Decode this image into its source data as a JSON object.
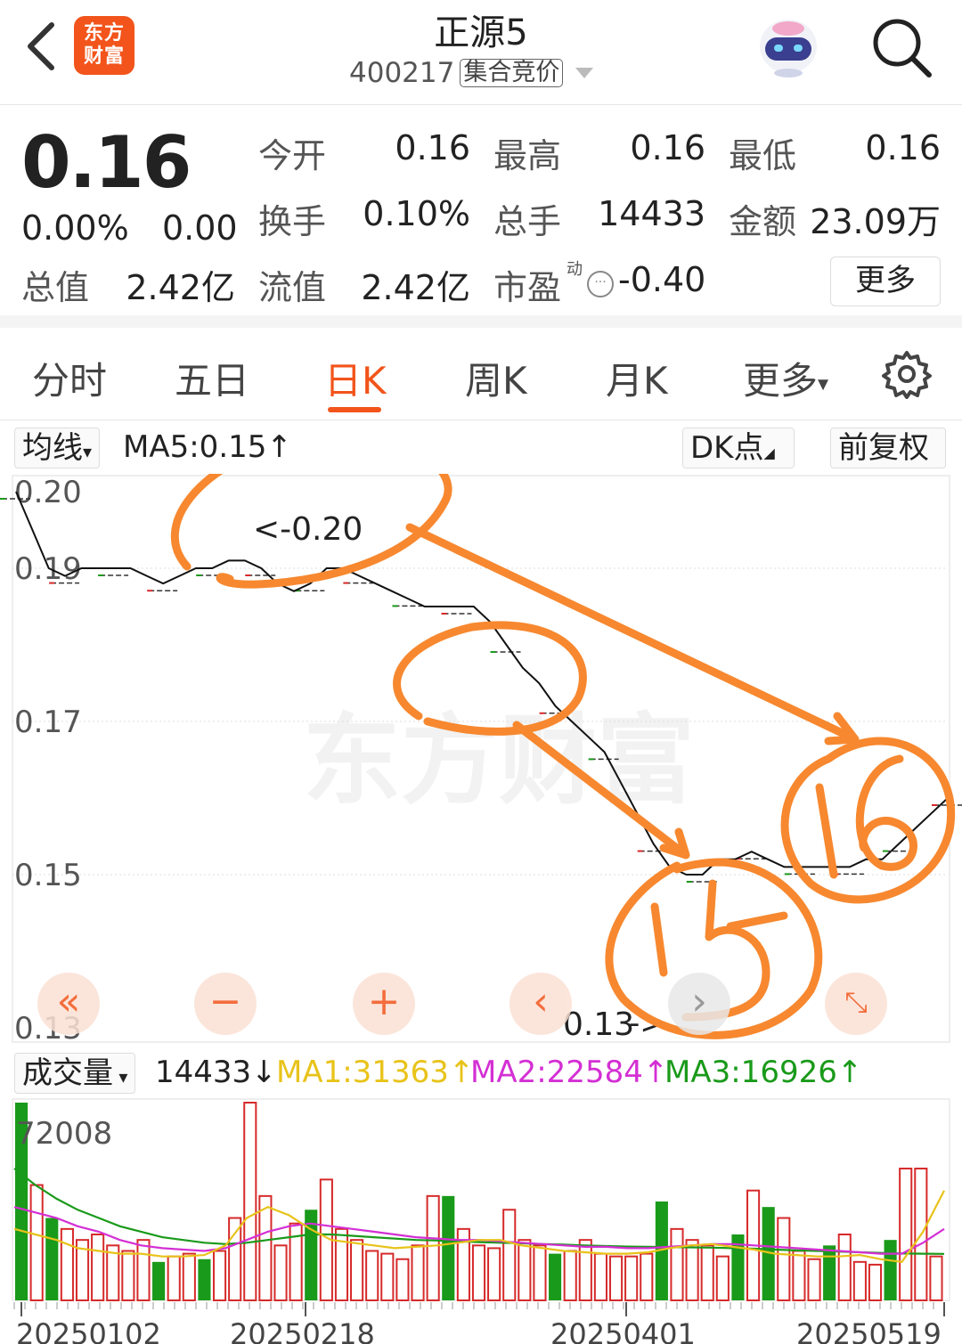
{
  "header": {
    "logo_text_line1": "东方",
    "logo_text_line2": "财富",
    "stock_name": "正源5",
    "stock_code": "400217",
    "auction_tag": "集合竞价"
  },
  "quote": {
    "price": "0.16",
    "change_pct": "0.00%",
    "change": "0.00",
    "open_label": "今开",
    "open": "0.16",
    "high_label": "最高",
    "high": "0.16",
    "low_label": "最低",
    "low": "0.16",
    "turnover_label": "换手",
    "turnover": "0.10%",
    "volume_label": "总手",
    "volume": "14433",
    "amount_label": "金额",
    "amount": "23.09万",
    "mcap_label": "总值",
    "mcap": "2.42亿",
    "float_label": "流值",
    "float": "2.42亿",
    "pe_label": "市盈",
    "pe_sup": "动",
    "pe": "-0.40",
    "more": "更多"
  },
  "tabs": [
    "分时",
    "五日",
    "日K",
    "周K",
    "月K",
    "更多"
  ],
  "active_tab": "日K",
  "indicator": {
    "ma_select": "均线",
    "ma5": "MA5:0.15",
    "dk_button": "DK点",
    "adjust_button": "前复权"
  },
  "volume_row": {
    "select": "成交量",
    "value": "14433",
    "ma1": "MA1:31363",
    "ma2": "MA2:22584",
    "ma3": "MA3:16926"
  },
  "annotations": {
    "top_marker": "<-0.20",
    "bottom_marker": "0.13",
    "handwritten_left": "15",
    "handwritten_right": "16"
  },
  "colors": {
    "brand": "#f2541b",
    "up": "#d62a2a",
    "down": "#1a9a1a",
    "ma1": "#e8c31a",
    "ma2": "#d42fd4",
    "ma3": "#1a9a1a",
    "annotation": "#f7882f"
  },
  "chart_data": [
    {
      "type": "line",
      "y_ticks": [
        "0.20",
        "0.19",
        "0.17",
        "0.15",
        "0.13"
      ],
      "ylim": [
        0.13,
        0.2
      ],
      "x_ticks": [
        "20250102",
        "20250218",
        "20250401",
        "20250519"
      ],
      "series": [
        {
          "name": "MA5",
          "values": [
            0.2,
            0.195,
            0.19,
            0.189,
            0.19,
            0.19,
            0.19,
            0.19,
            0.189,
            0.188,
            0.189,
            0.19,
            0.19,
            0.191,
            0.191,
            0.19,
            0.188,
            0.187,
            0.188,
            0.19,
            0.19,
            0.189,
            0.188,
            0.187,
            0.186,
            0.185,
            0.185,
            0.185,
            0.185,
            0.183,
            0.18,
            0.177,
            0.175,
            0.172,
            0.17,
            0.168,
            0.166,
            0.162,
            0.158,
            0.154,
            0.151,
            0.15,
            0.15,
            0.152,
            0.152,
            0.153,
            0.152,
            0.151,
            0.151,
            0.151,
            0.151,
            0.151,
            0.152,
            0.152,
            0.154,
            0.156,
            0.158,
            0.16
          ]
        }
      ]
    },
    {
      "type": "bar",
      "y_ticks": [
        "72008"
      ],
      "series": [
        {
          "name": "成交量",
          "values": [
            72008,
            42000,
            30000,
            26000,
            22000,
            24000,
            20000,
            18000,
            22000,
            14000,
            16000,
            17000,
            15000,
            18000,
            30000,
            72008,
            38000,
            20000,
            28000,
            33000,
            44000,
            26000,
            22000,
            18000,
            17000,
            15000,
            20000,
            38000,
            38000,
            26000,
            20000,
            19000,
            33000,
            22000,
            20000,
            17000,
            18000,
            22000,
            17000,
            16000,
            16000,
            17000,
            36000,
            26000,
            22000,
            20000,
            16000,
            24000,
            40000,
            34000,
            30000,
            18000,
            15000,
            20000,
            24000,
            14000,
            13000,
            22000,
            48000,
            48000,
            16000
          ]
        },
        {
          "name": "MA1",
          "values": [
            26000,
            24000,
            22000,
            19000,
            18000,
            17000,
            17000,
            16000,
            16000,
            16500,
            20000,
            30000,
            34000,
            31000,
            26000,
            22000,
            21000,
            20000,
            19000,
            19500,
            20000,
            21000,
            22000,
            22000,
            20000,
            19000,
            18000,
            17500,
            17000,
            17000,
            17500,
            19000,
            20000,
            20500,
            19500,
            18500,
            17000,
            16500,
            16000,
            16000,
            16500,
            15000,
            14000,
            25000,
            40000
          ]
        },
        {
          "name": "MA2",
          "values": [
            34000,
            32000,
            30000,
            27000,
            25000,
            22000,
            20000,
            19000,
            18500,
            18000,
            19000,
            22000,
            25000,
            27000,
            28000,
            27000,
            26000,
            25000,
            24000,
            23000,
            22500,
            22000,
            22000,
            21500,
            21000,
            20500,
            20000,
            19500,
            19500,
            19000,
            19000,
            19500,
            20000,
            20500,
            20500,
            20000,
            19500,
            19000,
            18500,
            18000,
            17500,
            17000,
            17000,
            21000,
            26000
          ]
        },
        {
          "name": "MA3",
          "values": [
            48000,
            42000,
            37000,
            33000,
            30000,
            27000,
            25000,
            23000,
            22000,
            21000,
            20500,
            21000,
            22000,
            23000,
            24000,
            24000,
            23500,
            23000,
            22500,
            22000,
            21800,
            21500,
            21200,
            21000,
            20800,
            20500,
            20300,
            20000,
            19800,
            19600,
            19500,
            19400,
            19300,
            19200,
            19000,
            18800,
            18500,
            18200,
            18000,
            17800,
            17500,
            17300,
            17100,
            17000,
            16926
          ]
        }
      ]
    }
  ]
}
